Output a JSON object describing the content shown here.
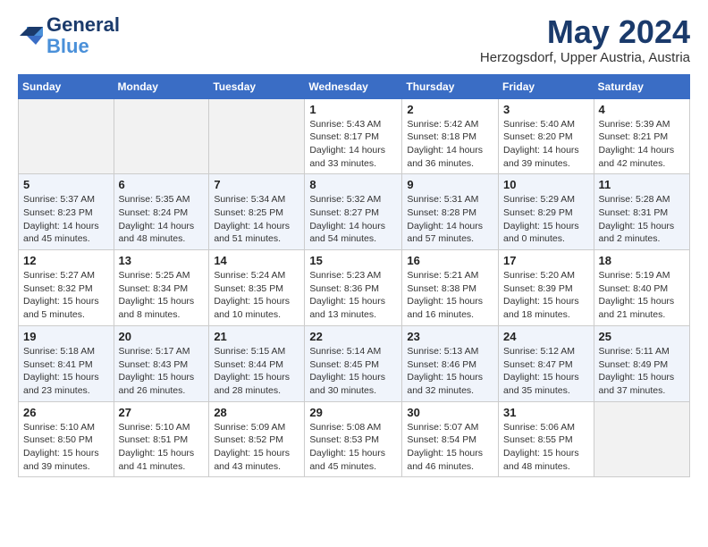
{
  "header": {
    "logo_line1": "General",
    "logo_line2": "Blue",
    "month": "May 2024",
    "location": "Herzogsdorf, Upper Austria, Austria"
  },
  "weekdays": [
    "Sunday",
    "Monday",
    "Tuesday",
    "Wednesday",
    "Thursday",
    "Friday",
    "Saturday"
  ],
  "weeks": [
    [
      {
        "day": "",
        "sunrise": "",
        "sunset": "",
        "daylight": ""
      },
      {
        "day": "",
        "sunrise": "",
        "sunset": "",
        "daylight": ""
      },
      {
        "day": "",
        "sunrise": "",
        "sunset": "",
        "daylight": ""
      },
      {
        "day": "1",
        "sunrise": "Sunrise: 5:43 AM",
        "sunset": "Sunset: 8:17 PM",
        "daylight": "Daylight: 14 hours and 33 minutes."
      },
      {
        "day": "2",
        "sunrise": "Sunrise: 5:42 AM",
        "sunset": "Sunset: 8:18 PM",
        "daylight": "Daylight: 14 hours and 36 minutes."
      },
      {
        "day": "3",
        "sunrise": "Sunrise: 5:40 AM",
        "sunset": "Sunset: 8:20 PM",
        "daylight": "Daylight: 14 hours and 39 minutes."
      },
      {
        "day": "4",
        "sunrise": "Sunrise: 5:39 AM",
        "sunset": "Sunset: 8:21 PM",
        "daylight": "Daylight: 14 hours and 42 minutes."
      }
    ],
    [
      {
        "day": "5",
        "sunrise": "Sunrise: 5:37 AM",
        "sunset": "Sunset: 8:23 PM",
        "daylight": "Daylight: 14 hours and 45 minutes."
      },
      {
        "day": "6",
        "sunrise": "Sunrise: 5:35 AM",
        "sunset": "Sunset: 8:24 PM",
        "daylight": "Daylight: 14 hours and 48 minutes."
      },
      {
        "day": "7",
        "sunrise": "Sunrise: 5:34 AM",
        "sunset": "Sunset: 8:25 PM",
        "daylight": "Daylight: 14 hours and 51 minutes."
      },
      {
        "day": "8",
        "sunrise": "Sunrise: 5:32 AM",
        "sunset": "Sunset: 8:27 PM",
        "daylight": "Daylight: 14 hours and 54 minutes."
      },
      {
        "day": "9",
        "sunrise": "Sunrise: 5:31 AM",
        "sunset": "Sunset: 8:28 PM",
        "daylight": "Daylight: 14 hours and 57 minutes."
      },
      {
        "day": "10",
        "sunrise": "Sunrise: 5:29 AM",
        "sunset": "Sunset: 8:29 PM",
        "daylight": "Daylight: 15 hours and 0 minutes."
      },
      {
        "day": "11",
        "sunrise": "Sunrise: 5:28 AM",
        "sunset": "Sunset: 8:31 PM",
        "daylight": "Daylight: 15 hours and 2 minutes."
      }
    ],
    [
      {
        "day": "12",
        "sunrise": "Sunrise: 5:27 AM",
        "sunset": "Sunset: 8:32 PM",
        "daylight": "Daylight: 15 hours and 5 minutes."
      },
      {
        "day": "13",
        "sunrise": "Sunrise: 5:25 AM",
        "sunset": "Sunset: 8:34 PM",
        "daylight": "Daylight: 15 hours and 8 minutes."
      },
      {
        "day": "14",
        "sunrise": "Sunrise: 5:24 AM",
        "sunset": "Sunset: 8:35 PM",
        "daylight": "Daylight: 15 hours and 10 minutes."
      },
      {
        "day": "15",
        "sunrise": "Sunrise: 5:23 AM",
        "sunset": "Sunset: 8:36 PM",
        "daylight": "Daylight: 15 hours and 13 minutes."
      },
      {
        "day": "16",
        "sunrise": "Sunrise: 5:21 AM",
        "sunset": "Sunset: 8:38 PM",
        "daylight": "Daylight: 15 hours and 16 minutes."
      },
      {
        "day": "17",
        "sunrise": "Sunrise: 5:20 AM",
        "sunset": "Sunset: 8:39 PM",
        "daylight": "Daylight: 15 hours and 18 minutes."
      },
      {
        "day": "18",
        "sunrise": "Sunrise: 5:19 AM",
        "sunset": "Sunset: 8:40 PM",
        "daylight": "Daylight: 15 hours and 21 minutes."
      }
    ],
    [
      {
        "day": "19",
        "sunrise": "Sunrise: 5:18 AM",
        "sunset": "Sunset: 8:41 PM",
        "daylight": "Daylight: 15 hours and 23 minutes."
      },
      {
        "day": "20",
        "sunrise": "Sunrise: 5:17 AM",
        "sunset": "Sunset: 8:43 PM",
        "daylight": "Daylight: 15 hours and 26 minutes."
      },
      {
        "day": "21",
        "sunrise": "Sunrise: 5:15 AM",
        "sunset": "Sunset: 8:44 PM",
        "daylight": "Daylight: 15 hours and 28 minutes."
      },
      {
        "day": "22",
        "sunrise": "Sunrise: 5:14 AM",
        "sunset": "Sunset: 8:45 PM",
        "daylight": "Daylight: 15 hours and 30 minutes."
      },
      {
        "day": "23",
        "sunrise": "Sunrise: 5:13 AM",
        "sunset": "Sunset: 8:46 PM",
        "daylight": "Daylight: 15 hours and 32 minutes."
      },
      {
        "day": "24",
        "sunrise": "Sunrise: 5:12 AM",
        "sunset": "Sunset: 8:47 PM",
        "daylight": "Daylight: 15 hours and 35 minutes."
      },
      {
        "day": "25",
        "sunrise": "Sunrise: 5:11 AM",
        "sunset": "Sunset: 8:49 PM",
        "daylight": "Daylight: 15 hours and 37 minutes."
      }
    ],
    [
      {
        "day": "26",
        "sunrise": "Sunrise: 5:10 AM",
        "sunset": "Sunset: 8:50 PM",
        "daylight": "Daylight: 15 hours and 39 minutes."
      },
      {
        "day": "27",
        "sunrise": "Sunrise: 5:10 AM",
        "sunset": "Sunset: 8:51 PM",
        "daylight": "Daylight: 15 hours and 41 minutes."
      },
      {
        "day": "28",
        "sunrise": "Sunrise: 5:09 AM",
        "sunset": "Sunset: 8:52 PM",
        "daylight": "Daylight: 15 hours and 43 minutes."
      },
      {
        "day": "29",
        "sunrise": "Sunrise: 5:08 AM",
        "sunset": "Sunset: 8:53 PM",
        "daylight": "Daylight: 15 hours and 45 minutes."
      },
      {
        "day": "30",
        "sunrise": "Sunrise: 5:07 AM",
        "sunset": "Sunset: 8:54 PM",
        "daylight": "Daylight: 15 hours and 46 minutes."
      },
      {
        "day": "31",
        "sunrise": "Sunrise: 5:06 AM",
        "sunset": "Sunset: 8:55 PM",
        "daylight": "Daylight: 15 hours and 48 minutes."
      },
      {
        "day": "",
        "sunrise": "",
        "sunset": "",
        "daylight": ""
      }
    ]
  ]
}
